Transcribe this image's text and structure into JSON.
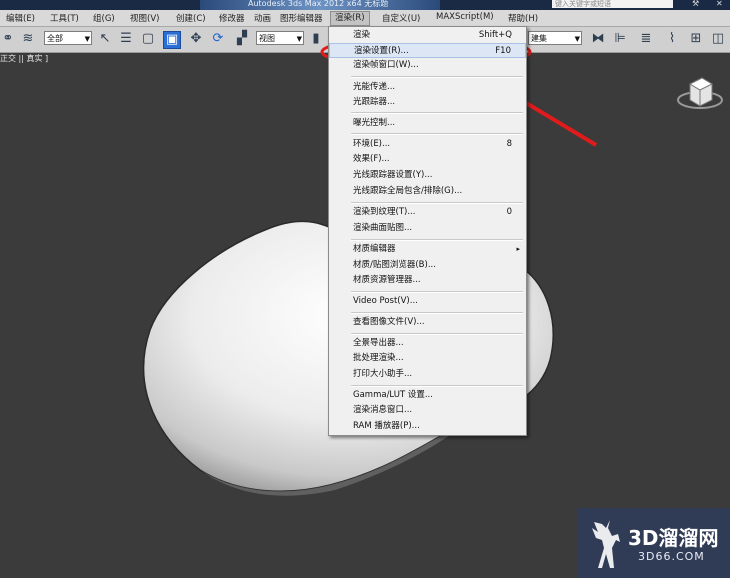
{
  "window": {
    "app_title": "Autodesk 3ds Max  2012 x64    无标题",
    "search_placeholder": "键入关键字或短语"
  },
  "menubar": {
    "items": [
      "编辑(E)",
      "工具(T)",
      "组(G)",
      "视图(V)",
      "创建(C)",
      "修改器",
      "动画",
      "图形编辑器",
      "渲染(R)",
      "自定义(U)",
      "MAXScript(M)",
      "帮助(H)"
    ],
    "active": "渲染(R)"
  },
  "toolbar": {
    "selection_filter": "全部",
    "reference_coord": "视图",
    "named_set": "建集"
  },
  "viewport": {
    "label": "正交 || 真实 ]",
    "background_color": "#3b3b3b"
  },
  "render_menu": {
    "groups": [
      [
        {
          "label": "渲染",
          "shortcut": "Shift+Q"
        },
        {
          "label": "渲染设置(R)...",
          "shortcut": "F10",
          "highlighted": true
        },
        {
          "label": "渲染帧窗口(W)...",
          "shortcut": ""
        }
      ],
      [
        {
          "label": "光能传递...",
          "shortcut": ""
        },
        {
          "label": "光跟踪器...",
          "shortcut": ""
        }
      ],
      [
        {
          "label": "曝光控制...",
          "shortcut": ""
        }
      ],
      [
        {
          "label": "环境(E)...",
          "shortcut": "8"
        },
        {
          "label": "效果(F)...",
          "shortcut": ""
        },
        {
          "label": "光线跟踪器设置(Y)...",
          "shortcut": ""
        },
        {
          "label": "光线跟踪全局包含/排除(G)...",
          "shortcut": ""
        }
      ],
      [
        {
          "label": "渲染到纹理(T)...",
          "shortcut": "0"
        },
        {
          "label": "渲染曲面贴图...",
          "shortcut": ""
        }
      ],
      [
        {
          "label": "材质编辑器",
          "shortcut": "",
          "submenu": true
        },
        {
          "label": "材质/贴图浏览器(B)...",
          "shortcut": ""
        },
        {
          "label": "材质资源管理器...",
          "shortcut": ""
        }
      ],
      [
        {
          "label": "Video Post(V)...",
          "shortcut": ""
        }
      ],
      [
        {
          "label": "查看图像文件(V)...",
          "shortcut": ""
        }
      ],
      [
        {
          "label": "全景导出器...",
          "shortcut": ""
        },
        {
          "label": "批处理渲染...",
          "shortcut": ""
        },
        {
          "label": "打印大小助手...",
          "shortcut": ""
        }
      ],
      [
        {
          "label": "Gamma/LUT 设置...",
          "shortcut": ""
        },
        {
          "label": "渲染消息窗口...",
          "shortcut": ""
        },
        {
          "label": "RAM 播放器(P)...",
          "shortcut": ""
        }
      ]
    ]
  },
  "annotation": {
    "color": "#e01b1b"
  },
  "watermark": {
    "title": "3D溜溜网",
    "url": "3D66.COM"
  }
}
